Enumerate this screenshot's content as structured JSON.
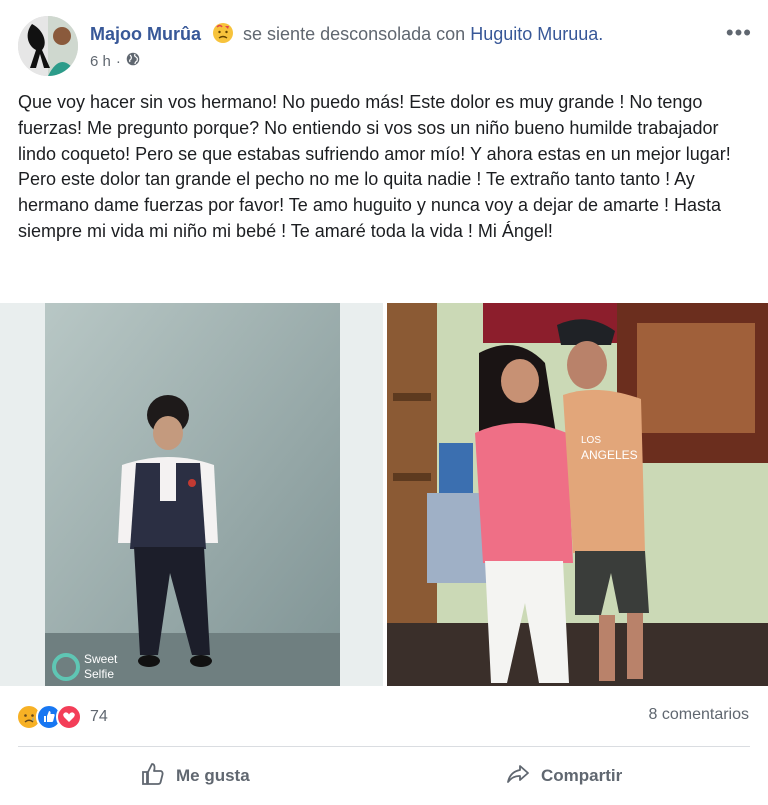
{
  "post": {
    "author": "Majoo Murûa",
    "feeling_text": "se siente desconsolada con",
    "tagged": "Huguito Muruua.",
    "time": "6 h",
    "more": "•••",
    "feeling_icon": "sad-face-emoji",
    "audience_icon": "globe-icon",
    "body": "Que voy hacer sin vos hermano! No puedo más! Este dolor es muy grande ! No tengo fuerzas! Me pregunto porque? No entiendo si vos sos un niño bueno humilde trabajador lindo coqueto! Pero se que estabas sufriendo amor mío! Y ahora estas en un mejor lugar! Pero este dolor tan grande el pecho no me lo quita nadie ! Te extraño tanto tanto ! Ay hermano dame fuerzas por favor! Te amo huguito y nunca voy a dejar de amarte ! Hasta siempre mi vida mi niño mi bebé ! Te amaré toda la vida ! Mi Ángel!"
  },
  "photos": {
    "left": {
      "watermark_line1": "Sweet",
      "watermark_line2": "Selfie"
    },
    "right": {
      "shirt_text_1": "LOS",
      "shirt_text_2": "ANGELES"
    }
  },
  "engagement": {
    "reaction_count": "74",
    "reaction_icons": [
      "sad-reaction-icon",
      "like-reaction-icon",
      "love-reaction-icon"
    ],
    "comments": "8 comentarios"
  },
  "actions": {
    "like_label": "Me gusta",
    "share_label": "Compartir"
  },
  "colors": {
    "link": "#385898",
    "secondary": "#606770",
    "text": "#1c1e21",
    "like_blue": "#1877f2",
    "love_red": "#f33e58",
    "sad_yellow": "#f7b125"
  }
}
